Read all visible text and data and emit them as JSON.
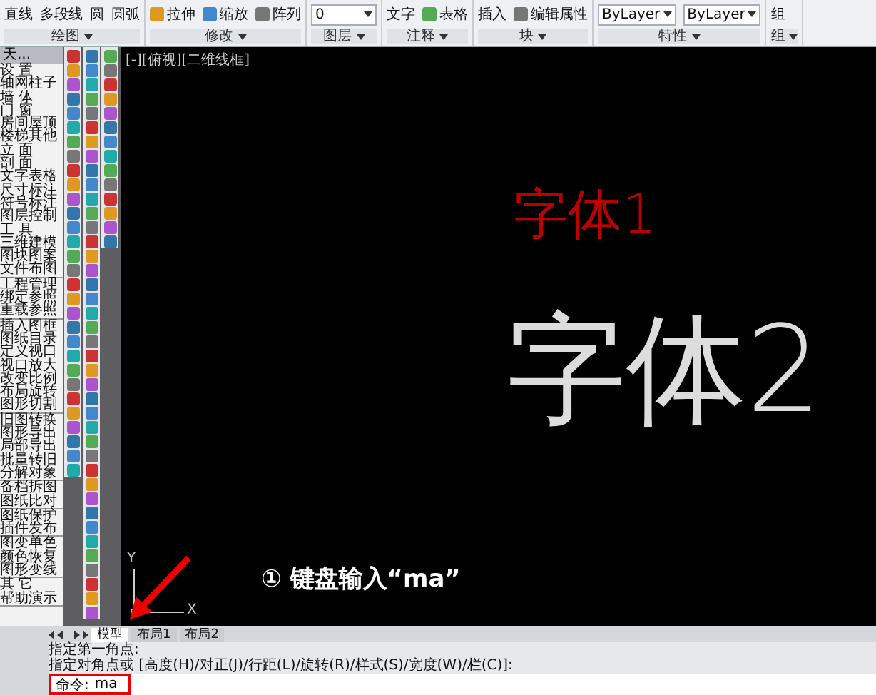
{
  "ribbon": {
    "panels": [
      {
        "title": "绘图",
        "items": [
          {
            "label": "直线",
            "kind": "big"
          },
          {
            "label": "多段线",
            "kind": "big"
          },
          {
            "label": "圆",
            "kind": "big"
          },
          {
            "label": "圆弧",
            "kind": "big"
          }
        ]
      },
      {
        "title": "修改",
        "items": [
          {
            "label": "拉伸",
            "kind": "small"
          },
          {
            "label": "缩放",
            "kind": "small"
          },
          {
            "label": "阵列",
            "kind": "small"
          }
        ]
      },
      {
        "title": "图层",
        "items": [
          {
            "label": "0",
            "kind": "dropdown"
          }
        ]
      },
      {
        "title": "注释",
        "items": [
          {
            "label": "文字",
            "kind": "big"
          },
          {
            "label": "表格",
            "kind": "small"
          }
        ]
      },
      {
        "title": "块",
        "items": [
          {
            "label": "插入",
            "kind": "big"
          },
          {
            "label": "编辑属性",
            "kind": "small"
          }
        ]
      },
      {
        "title": "特性",
        "items": [
          {
            "label": "ByLayer",
            "kind": "dropdown"
          },
          {
            "label": "ByLayer",
            "kind": "dropdown"
          }
        ]
      },
      {
        "title": "组",
        "items": [
          {
            "label": "组",
            "kind": "big"
          }
        ]
      }
    ]
  },
  "palette": {
    "title": "天...",
    "groups": [
      [
        "设 置",
        "轴网柱子",
        "墙 体",
        "门 窗",
        "房间屋顶",
        "楼梯其他",
        "立 面",
        "剖 面",
        "文字表格",
        "尺寸标注",
        "符号标注",
        "图层控制",
        "工 具",
        "三维建模",
        "图块图案",
        "文件布图"
      ],
      [
        "工程管理",
        "绑定参照",
        "重载参照"
      ],
      [
        "插入图框",
        "图纸目录",
        "定义视口",
        "视口放大",
        "改变比例",
        "布局旋转",
        "图形切割"
      ],
      [
        "旧图转换",
        "图形导出",
        "局部导出",
        "批量转旧",
        "分解对象"
      ],
      [
        "备档拆图",
        "图纸比对"
      ],
      [
        "图纸保护",
        "插件发布"
      ],
      [
        "图变单色",
        "颜色恢复",
        "图形变线"
      ],
      [
        "其 它",
        "帮助演示"
      ]
    ]
  },
  "viewport": {
    "label": "[-][俯视][二维线框]",
    "texts": [
      {
        "text": "字体1",
        "kind": "small"
      },
      {
        "text": "字体2",
        "kind": "large"
      }
    ],
    "ucs": {
      "x": "X",
      "y": "Y"
    }
  },
  "annotation": {
    "step": "①",
    "text": "键盘输入“ma”"
  },
  "layout_tabs": [
    {
      "label": "模型",
      "selected": true
    },
    {
      "label": "布局1",
      "selected": false
    },
    {
      "label": "布局2",
      "selected": false
    }
  ],
  "command": {
    "history": [
      "指定第一角点:",
      "指定对角点或 [高度(H)/对正(J)/行距(L)/旋转(R)/样式(S)/宽度(W)/栏(C)]:"
    ],
    "prompt": "命令:",
    "value": "ma"
  }
}
